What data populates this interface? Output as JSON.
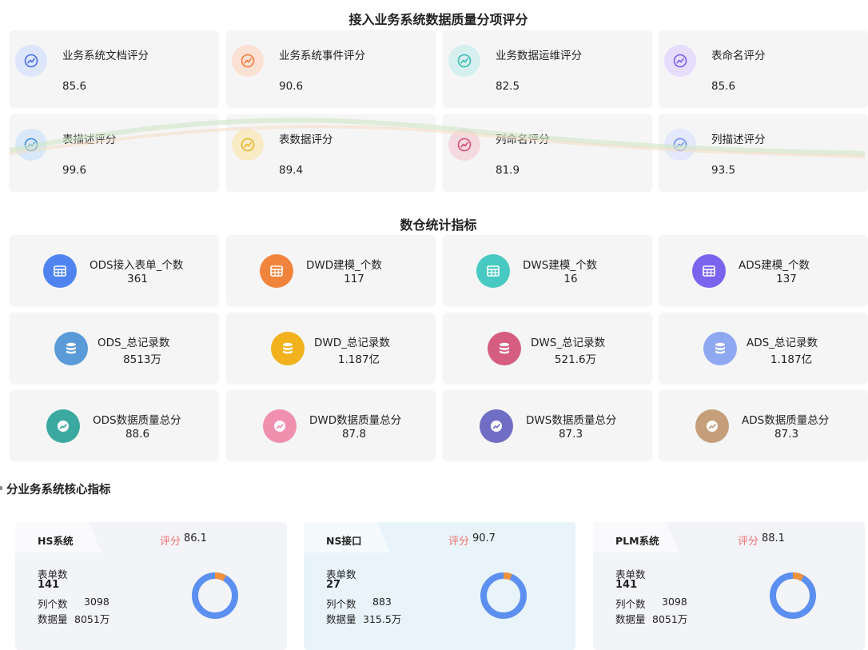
{
  "quality_section": {
    "title": "接入业务系统数据质量分项评分",
    "items": [
      {
        "label": "业务系统文档评分",
        "value": "85.6",
        "icon": "trend-icon",
        "color": "#4a6ee8",
        "bg": "#dde6fb"
      },
      {
        "label": "业务系统事件评分",
        "value": "90.6",
        "icon": "trend-icon",
        "color": "#ee7b3c",
        "bg": "#fbe1d3"
      },
      {
        "label": "业务数据运维评分",
        "value": "82.5",
        "icon": "trend-icon",
        "color": "#3bb9b3",
        "bg": "#d5f0ee"
      },
      {
        "label": "表命名评分",
        "value": "85.6",
        "icon": "trend-icon",
        "color": "#7a5ee8",
        "bg": "#e5ddfb"
      },
      {
        "label": "表描述评分",
        "value": "99.6",
        "icon": "trend-icon",
        "color": "#3a8ee0",
        "bg": "#d9e8f8"
      },
      {
        "label": "表数据评分",
        "value": "89.4",
        "icon": "trend-icon",
        "color": "#e8b526",
        "bg": "#f8ebc6"
      },
      {
        "label": "列命名评分",
        "value": "81.9",
        "icon": "trend-icon",
        "color": "#d34f73",
        "bg": "#f4d9e0"
      },
      {
        "label": "列描述评分",
        "value": "93.5",
        "icon": "trend-icon",
        "color": "#6c8ef0",
        "bg": "#e3e9fb"
      }
    ]
  },
  "warehouse_section": {
    "title": "数仓统计指标",
    "items": [
      {
        "label": "ODS接入表单_个数",
        "value": "361",
        "icon": "table-icon",
        "color": "#4f84f0"
      },
      {
        "label": "DWD建模_个数",
        "value": "117",
        "icon": "table-icon",
        "color": "#f0843c"
      },
      {
        "label": "DWS建模_个数",
        "value": "16",
        "icon": "table-icon",
        "color": "#48c9c2"
      },
      {
        "label": "ADS建模_个数",
        "value": "137",
        "icon": "table-icon",
        "color": "#7a64ee"
      },
      {
        "label": "ODS_总记录数",
        "value": "8513万",
        "icon": "database-icon",
        "color": "#5a9ad8"
      },
      {
        "label": "DWD_总记录数",
        "value": "1.187亿",
        "icon": "database-icon",
        "color": "#f2b21e"
      },
      {
        "label": "DWS_总记录数",
        "value": "521.6万",
        "icon": "database-icon",
        "color": "#d45d80"
      },
      {
        "label": "ADS_总记录数",
        "value": "1.187亿",
        "icon": "database-icon",
        "color": "#8fa8f2"
      },
      {
        "label": "ODS数据质量总分",
        "value": "88.6",
        "icon": "trend-circle-icon",
        "color": "#3ba99f"
      },
      {
        "label": "DWD数据质量总分",
        "value": "87.8",
        "icon": "trend-circle-icon",
        "color": "#f08fae"
      },
      {
        "label": "DWS数据质量总分",
        "value": "87.3",
        "icon": "trend-circle-icon",
        "color": "#6f6ec4"
      },
      {
        "label": "ADS数据质量总分",
        "value": "87.3",
        "icon": "trend-circle-icon",
        "color": "#c49f7a"
      }
    ]
  },
  "core_section": {
    "title": "分业务系统核心指标",
    "score_label": "评分",
    "form_count_label": "表单数",
    "column_count_label": "列个数",
    "data_volume_label": "数据量",
    "systems": [
      {
        "name": "HS系统",
        "score": "86.1",
        "form_count": "141",
        "column_count": "3098",
        "data_volume": "8051万",
        "bg": "#f3f4f8",
        "donut_fraction": 0.08
      },
      {
        "name": "NS接口",
        "score": "90.7",
        "form_count": "27",
        "column_count": "883",
        "data_volume": "315.5万",
        "bg": "#e8f4f9",
        "donut_fraction": 0.06
      },
      {
        "name": "PLM系统",
        "score": "88.1",
        "form_count": "141",
        "column_count": "3098",
        "data_volume": "8051万",
        "bg": "#f3f4f8",
        "donut_fraction": 0.08
      }
    ],
    "donut_colors": {
      "main": "#5b8ff0",
      "accent": "#f0923c"
    }
  }
}
